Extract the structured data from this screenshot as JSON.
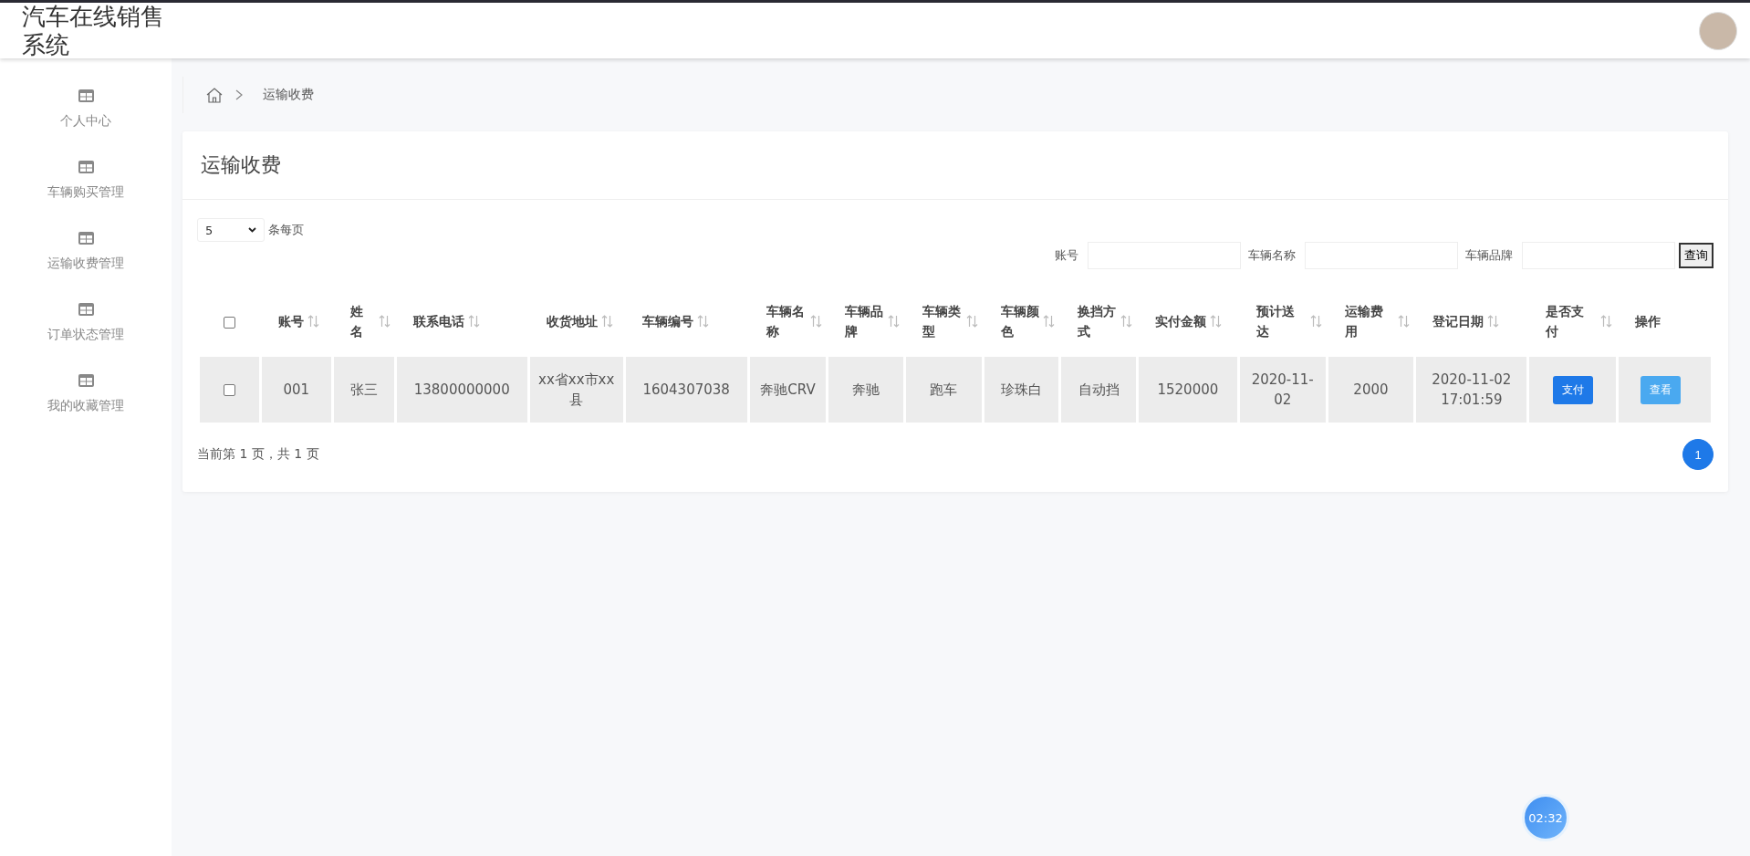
{
  "header": {
    "title": "汽车在线销售系统"
  },
  "sidebar": {
    "items": [
      {
        "label": "个人中心",
        "selected": false
      },
      {
        "label": "车辆购买管理",
        "selected": false
      },
      {
        "label": "运输收费管理",
        "selected": false
      },
      {
        "label": "订单状态管理",
        "selected": false
      },
      {
        "label": "我的收藏管理",
        "selected": false
      }
    ]
  },
  "breadcrumb": {
    "current": "运输收费"
  },
  "card": {
    "title": "运输收费"
  },
  "page_size": {
    "value": "5",
    "label": "条每页"
  },
  "search": {
    "fields": [
      {
        "label": "账号"
      },
      {
        "label": "车辆名称"
      },
      {
        "label": "车辆品牌"
      }
    ],
    "button": "查询"
  },
  "table": {
    "select_all_checked": false,
    "columns": [
      {
        "label": "账号",
        "sortable": true
      },
      {
        "label": "姓名",
        "sortable": true
      },
      {
        "label": "联系电话",
        "sortable": true
      },
      {
        "label": "收货地址",
        "sortable": true
      },
      {
        "label": "车辆编号",
        "sortable": true
      },
      {
        "label": "车辆名称",
        "sortable": true
      },
      {
        "label": "车辆品牌",
        "sortable": true
      },
      {
        "label": "车辆类型",
        "sortable": true
      },
      {
        "label": "车辆颜色",
        "sortable": true
      },
      {
        "label": "换挡方式",
        "sortable": true
      },
      {
        "label": "实付金额",
        "sortable": true
      },
      {
        "label": "预计送达",
        "sortable": true
      },
      {
        "label": "运输费用",
        "sortable": true
      },
      {
        "label": "登记日期",
        "sortable": true
      },
      {
        "label": "是否支付",
        "sortable": true
      },
      {
        "label": "操作",
        "sortable": false
      }
    ],
    "rows": [
      {
        "checked": false,
        "cells": [
          "001",
          "张三",
          "13800000000",
          "xx省xx市xx县",
          "1604307038",
          "奔驰CRV",
          "奔驰",
          "跑车",
          "珍珠白",
          "自动挡",
          "1520000",
          "2020-11-02",
          "2000",
          "2020-11-02 17:01:59"
        ],
        "pay_button": "支付",
        "view_button": "查看"
      }
    ]
  },
  "pagination": {
    "summary": "当前第 1 页，共 1 页",
    "pages": [
      {
        "label": "1",
        "selected": true
      }
    ]
  },
  "timer": {
    "time": "02:32"
  }
}
